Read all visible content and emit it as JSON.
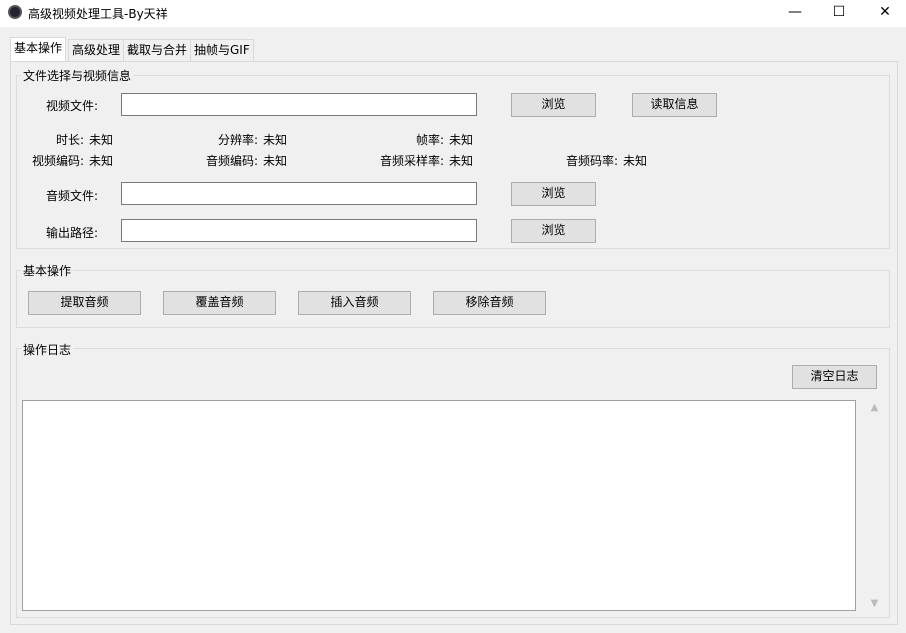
{
  "window": {
    "title": "高级视频处理工具-By天祥",
    "minimize": "—",
    "maximize": "☐",
    "close": "✕"
  },
  "tabs": [
    "基本操作",
    "高级处理",
    "截取与合并",
    "抽帧与GIF"
  ],
  "file_group": {
    "title": "文件选择与视频信息",
    "video_label": "视频文件:",
    "video_value": "",
    "browse": "浏览",
    "read_info": "读取信息",
    "audio_label": "音频文件:",
    "audio_value": "",
    "output_label": "输出路径:",
    "output_value": ""
  },
  "info": {
    "duration_label": "时长:",
    "duration": "未知",
    "resolution_label": "分辨率:",
    "resolution": "未知",
    "fps_label": "帧率:",
    "fps": "未知",
    "vcodec_label": "视频编码:",
    "vcodec": "未知",
    "acodec_label": "音频编码:",
    "acodec": "未知",
    "samplerate_label": "音频采样率:",
    "samplerate": "未知",
    "abitrate_label": "音频码率:",
    "abitrate": "未知"
  },
  "ops_group": {
    "title": "基本操作",
    "buttons": [
      "提取音频",
      "覆盖音频",
      "插入音频",
      "移除音频"
    ]
  },
  "log_group": {
    "title": "操作日志",
    "clear": "清空日志",
    "content": ""
  }
}
